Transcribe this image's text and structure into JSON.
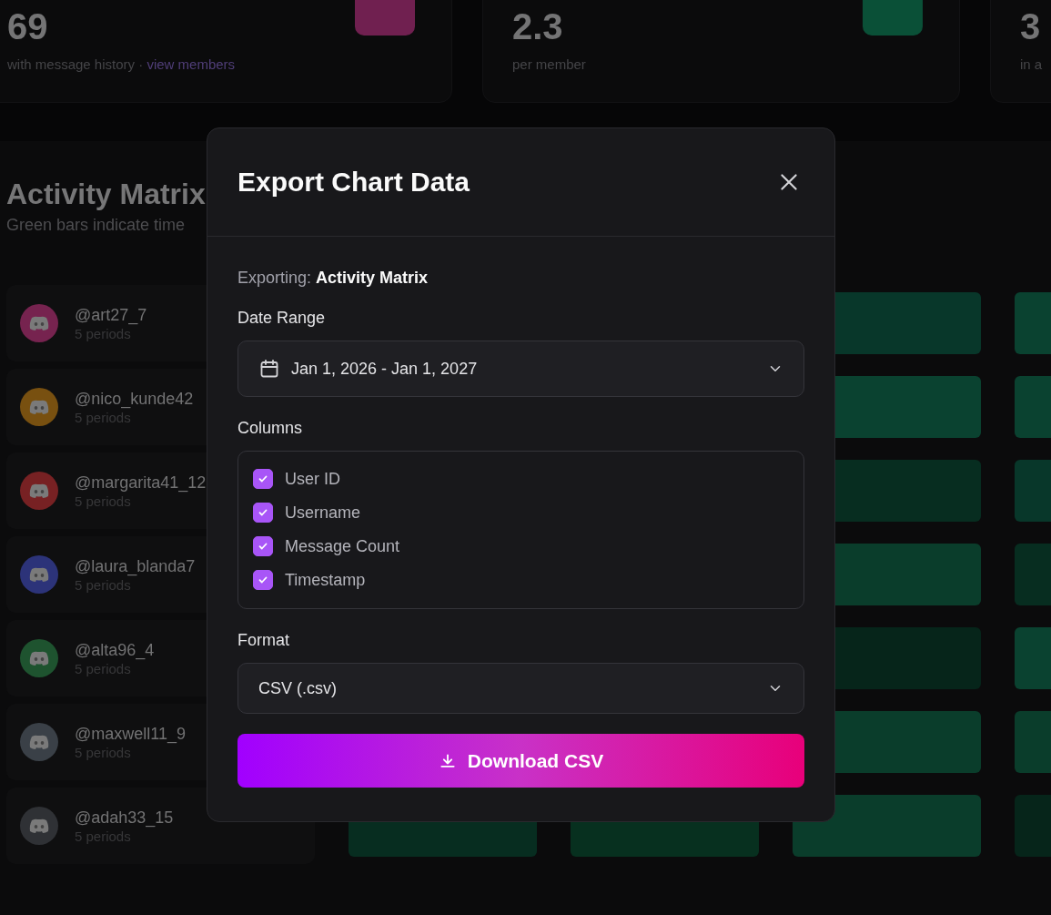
{
  "stats": [
    {
      "value": "69",
      "caption": "with message history · ",
      "link": "view members",
      "color": "#702050"
    },
    {
      "value": "2.3",
      "caption": "per member",
      "color": "#0a5037"
    },
    {
      "value": "3",
      "caption": "in a"
    }
  ],
  "activity_matrix": {
    "title": "Activity Matrix",
    "subtitle": "Green bars indicate time",
    "rows": [
      {
        "username": "@art27_7",
        "periods": "5 periods",
        "color": "#76234f",
        "cells": [
          {
            "color": "#08372a"
          },
          {
            "color": "#0a4230"
          }
        ]
      },
      {
        "username": "@nico_kunde42",
        "periods": "5 periods",
        "color": "#785010",
        "cells": [
          {
            "color": "#0a4230"
          },
          {
            "color": "#0a4230"
          }
        ]
      },
      {
        "username": "@margarita41_12",
        "periods": "5 periods",
        "color": "#772123",
        "cells": [
          {
            "color": "#072d20"
          },
          {
            "color": "#08372a"
          }
        ]
      },
      {
        "username": "@laura_blanda7",
        "periods": "5 periods",
        "color": "#2c3379",
        "cells": [
          {
            "color": "#0a3d2b"
          },
          {
            "color": "#072d20"
          }
        ]
      },
      {
        "username": "@alta96_4",
        "periods": "5 periods",
        "color": "#1e532f",
        "cells": [
          {
            "color": "#06251a"
          },
          {
            "color": "#0a4230"
          }
        ]
      },
      {
        "username": "@maxwell11_9",
        "periods": "5 periods",
        "color": "#3a4047",
        "cells": [
          {
            "color": "#0a3d2b"
          },
          {
            "color": "#0a3d2b"
          }
        ]
      },
      {
        "username": "@adah33_15",
        "periods": "5 periods",
        "color": "#2f3135",
        "cells": [
          {
            "color": "#072d20"
          },
          {
            "color": "#07301f"
          },
          {
            "color": "#0a3d2b"
          },
          {
            "color": "#06251a"
          }
        ]
      }
    ]
  },
  "export": {
    "title": "Export Chart Data",
    "exporting_label": "Exporting:",
    "exporting_value": "Activity Matrix",
    "date_range": {
      "label": "Date Range",
      "value": "Jan 1, 2026 - Jan 1, 2027"
    },
    "columns": {
      "label": "Columns",
      "items": [
        {
          "label": "User ID",
          "checked": true
        },
        {
          "label": "Username",
          "checked": true
        },
        {
          "label": "Message Count",
          "checked": true
        },
        {
          "label": "Timestamp",
          "checked": true
        }
      ]
    },
    "format": {
      "label": "Format",
      "value": "CSV (.csv)"
    },
    "button": "Download CSV"
  }
}
